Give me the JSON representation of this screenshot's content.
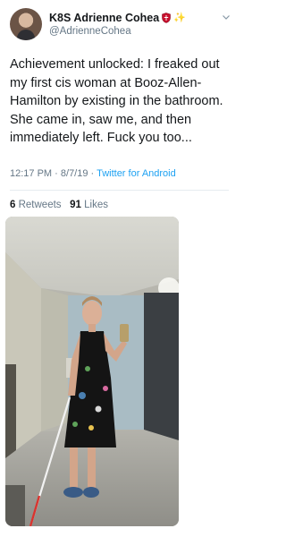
{
  "tweet": {
    "display_name": "K8S Adrienne Cohea",
    "handle": "@AdrienneCohea",
    "text": "Achievement unlocked: I freaked out my first cis woman at Booz-Allen-Hamilton by existing in the bathroom. She came in, saw me, and then immediately left. Fuck you too...",
    "time": "12:17 PM",
    "separator": "·",
    "date": "8/7/19",
    "source": "Twitter for Android",
    "retweets_count": "6",
    "retweets_label": "Retweets",
    "likes_count": "91",
    "likes_label": "Likes"
  },
  "icons": {
    "shield": "shield-emoji",
    "sparkle": "sparkles-emoji",
    "chevron": "chevron-down"
  },
  "colors": {
    "link": "#1da1f2",
    "secondary_text": "#657786",
    "primary_text": "#14171a"
  }
}
